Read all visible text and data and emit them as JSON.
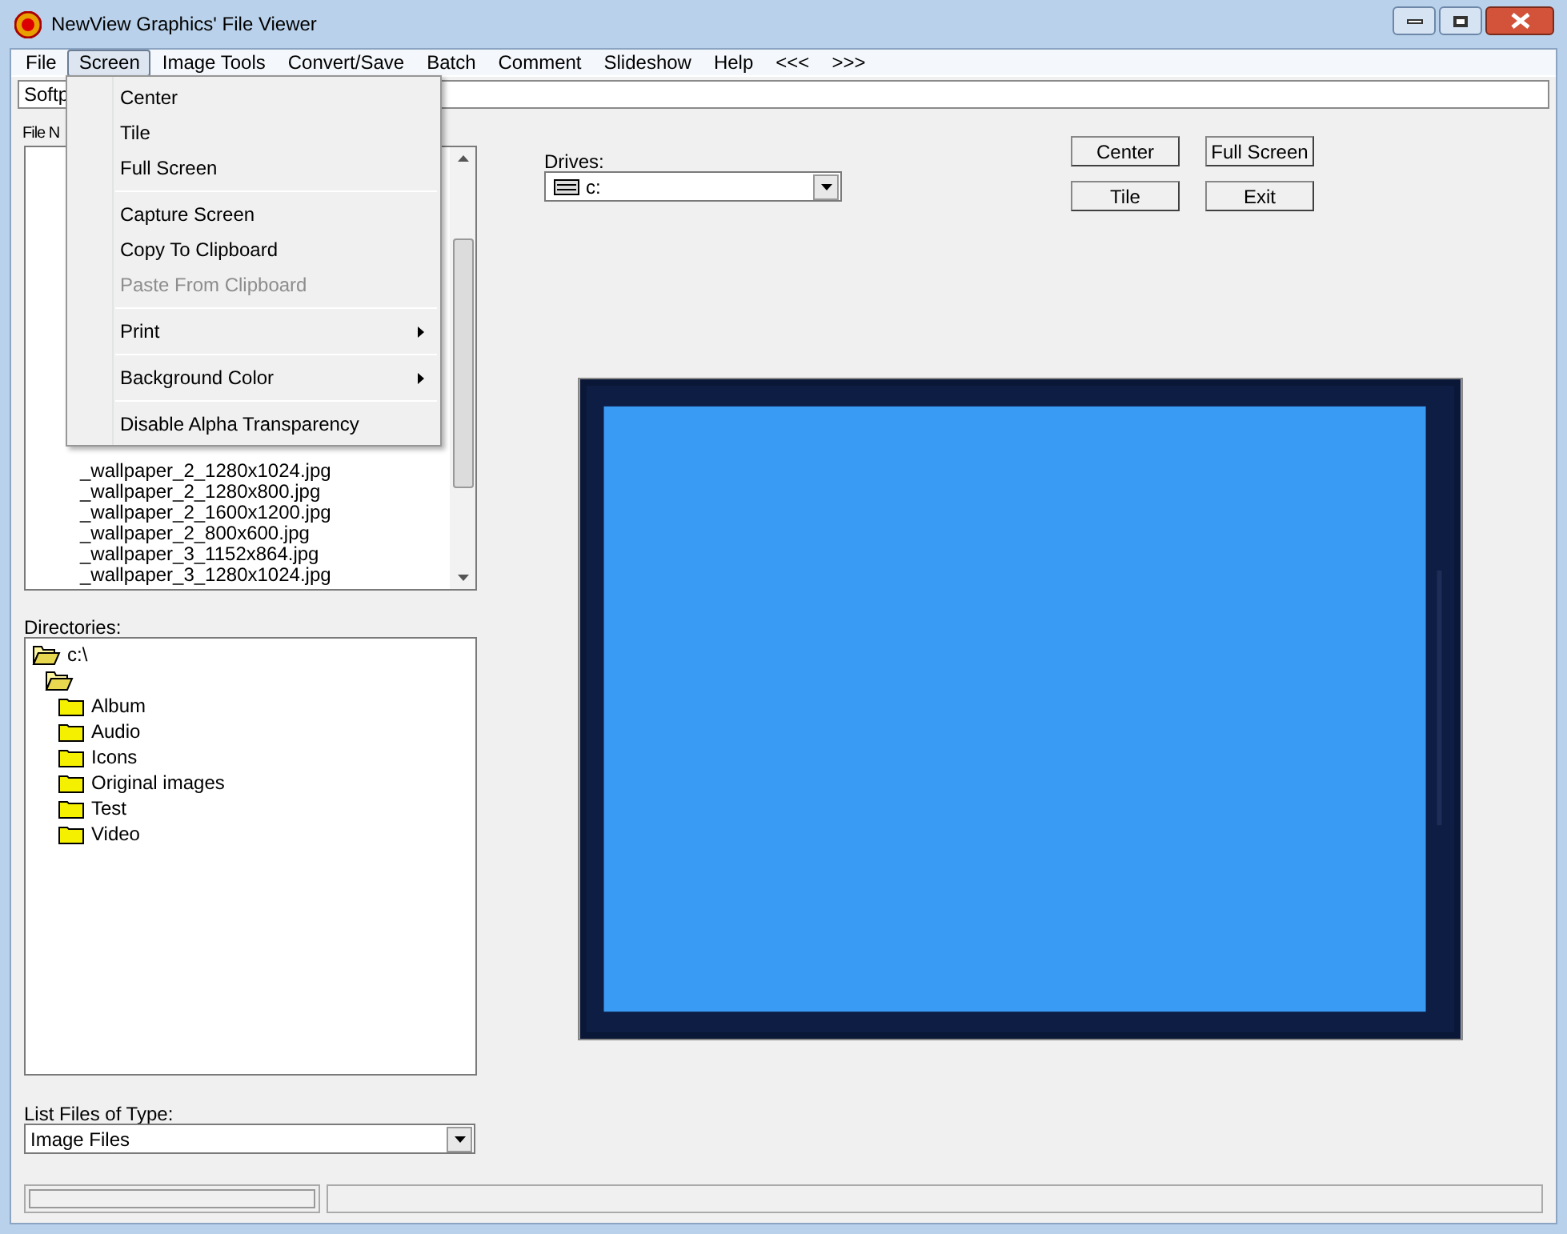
{
  "window": {
    "title": "NewView Graphics' File Viewer"
  },
  "menu_bar": [
    {
      "label": "File",
      "selected": false
    },
    {
      "label": "Screen",
      "selected": true
    },
    {
      "label": "Image Tools",
      "selected": false
    },
    {
      "label": "Convert/Save",
      "selected": false
    },
    {
      "label": "Batch",
      "selected": false
    },
    {
      "label": "Comment",
      "selected": false
    },
    {
      "label": "Slideshow",
      "selected": false
    },
    {
      "label": "Help",
      "selected": false
    },
    {
      "label": "<<<",
      "selected": false
    },
    {
      "label": ">>>",
      "selected": false
    }
  ],
  "screen_menu": [
    {
      "kind": "item",
      "label": "Center",
      "disabled": false
    },
    {
      "kind": "item",
      "label": "Tile",
      "disabled": false
    },
    {
      "kind": "item",
      "label": "Full Screen",
      "disabled": false
    },
    {
      "kind": "separator"
    },
    {
      "kind": "item",
      "label": "Capture Screen",
      "disabled": false
    },
    {
      "kind": "item",
      "label": "Copy To Clipboard",
      "disabled": false
    },
    {
      "kind": "item",
      "label": "Paste From Clipboard",
      "disabled": true
    },
    {
      "kind": "separator"
    },
    {
      "kind": "submenu",
      "label": "Print",
      "disabled": false
    },
    {
      "kind": "separator"
    },
    {
      "kind": "submenu",
      "label": "Background Color",
      "disabled": false
    },
    {
      "kind": "separator"
    },
    {
      "kind": "item",
      "label": "Disable Alpha Transparency",
      "disabled": false
    }
  ],
  "path_field": {
    "value": "Softp"
  },
  "file_list": {
    "label": "File N",
    "files": [
      "_wallpaper_2_1280x1024.jpg",
      "_wallpaper_2_1280x800.jpg",
      "_wallpaper_2_1600x1200.jpg",
      "_wallpaper_2_800x600.jpg",
      "_wallpaper_3_1152x864.jpg",
      "_wallpaper_3_1280x1024.jpg"
    ]
  },
  "directories": {
    "label": "Directories:",
    "tree": [
      {
        "label": "c:\\",
        "open": true,
        "children": [
          {
            "open": true,
            "children": [
              {
                "label": "Album",
                "open": false
              },
              {
                "label": "Audio",
                "open": false
              },
              {
                "label": "Icons",
                "open": false
              },
              {
                "label": "Original images",
                "open": false
              },
              {
                "label": "Test",
                "open": false
              },
              {
                "label": "Video",
                "open": false
              }
            ]
          }
        ]
      }
    ]
  },
  "file_type": {
    "label": "List Files of Type:",
    "value": "Image Files"
  },
  "drives": {
    "label": "Drives:",
    "value": "c:"
  },
  "buttons": [
    [
      "Center",
      "Full Screen"
    ],
    [
      "Tile",
      "Exit"
    ]
  ]
}
